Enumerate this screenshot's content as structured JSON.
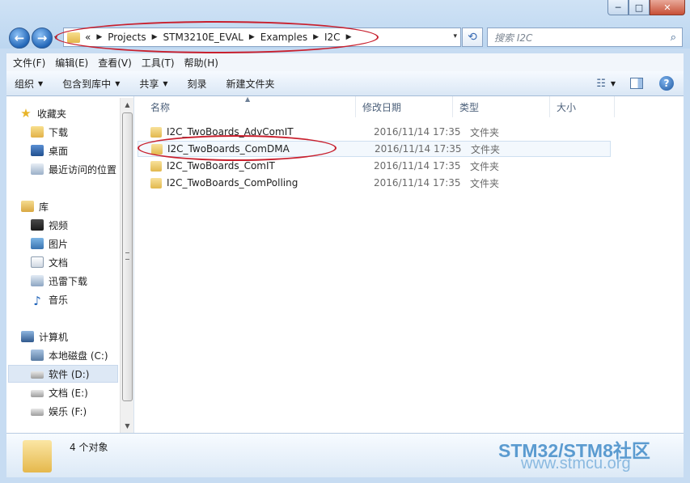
{
  "nav": {
    "back_glyph": "←",
    "forward_glyph": "→",
    "recent_glyph": "▾"
  },
  "address": {
    "overflow": "«",
    "crumbs": [
      "Projects",
      "STM3210E_EVAL",
      "Examples",
      "I2C"
    ],
    "sep": "▶",
    "dropdown": "▾",
    "refresh_glyph": "⟲"
  },
  "search": {
    "placeholder": "搜索 I2C"
  },
  "caption": {
    "min": "─",
    "max": "□",
    "close": "✕"
  },
  "menubar": [
    "文件(F)",
    "编辑(E)",
    "查看(V)",
    "工具(T)",
    "帮助(H)"
  ],
  "toolbar": {
    "organize": "组织",
    "include_library": "包含到库中",
    "share": "共享",
    "burn": "刻录",
    "new_folder": "新建文件夹",
    "help": "?"
  },
  "navpane": {
    "favorites": "收藏夹",
    "downloads": "下载",
    "desktop": "桌面",
    "recent": "最近访问的位置",
    "libraries": "库",
    "videos": "视频",
    "pictures": "图片",
    "documents": "文档",
    "xunlei": "迅雷下载",
    "music": "音乐",
    "computer": "计算机",
    "drive_c": "本地磁盘 (C:)",
    "drive_d": "软件 (D:)",
    "drive_e": "文档 (E:)",
    "drive_f": "娱乐 (F:)"
  },
  "columns": {
    "name": "名称",
    "date": "修改日期",
    "type": "类型",
    "size": "大小"
  },
  "files": [
    {
      "name": "I2C_TwoBoards_AdvComIT",
      "date": "2016/11/14 17:35",
      "type": "文件夹"
    },
    {
      "name": "I2C_TwoBoards_ComDMA",
      "date": "2016/11/14 17:35",
      "type": "文件夹"
    },
    {
      "name": "I2C_TwoBoards_ComIT",
      "date": "2016/11/14 17:35",
      "type": "文件夹"
    },
    {
      "name": "I2C_TwoBoards_ComPolling",
      "date": "2016/11/14 17:35",
      "type": "文件夹"
    }
  ],
  "details": {
    "count": "4 个对象"
  },
  "watermark": {
    "line1": "STM32/STM8社区",
    "line2": "www.stmcu.org"
  }
}
